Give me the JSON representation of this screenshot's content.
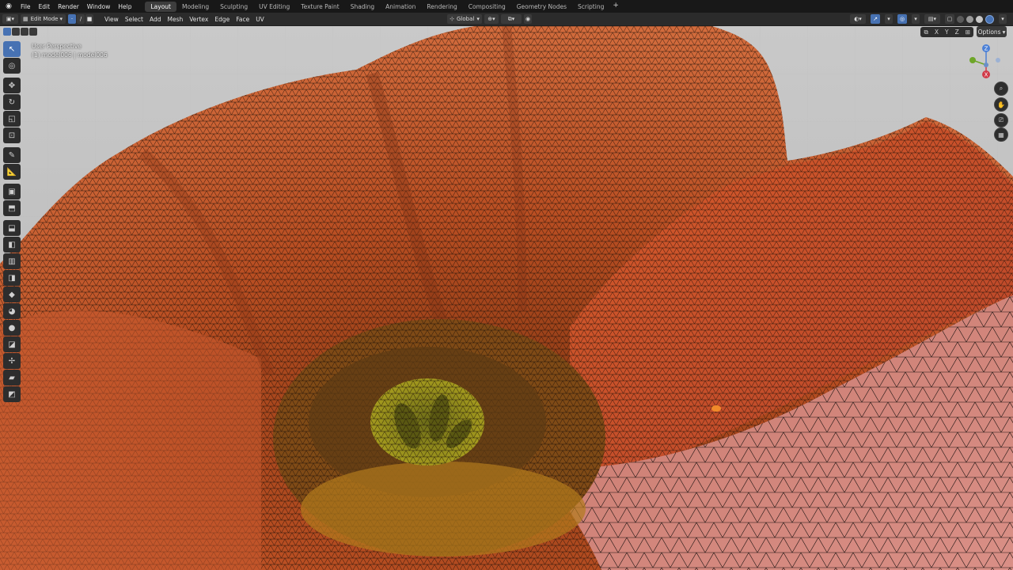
{
  "menu": [
    "File",
    "Edit",
    "Render",
    "Window",
    "Help"
  ],
  "workspaces": [
    "Layout",
    "Modeling",
    "Sculpting",
    "UV Editing",
    "Texture Paint",
    "Shading",
    "Animation",
    "Rendering",
    "Compositing",
    "Geometry Nodes",
    "Scripting"
  ],
  "active_workspace": "Layout",
  "header": {
    "mode": "Edit Mode",
    "view_menu": [
      "View",
      "Select",
      "Add",
      "Mesh",
      "Vertex",
      "Edge",
      "Face",
      "UV"
    ],
    "orientation": "Global",
    "options_label": "Options",
    "axes": [
      "X",
      "Y",
      "Z"
    ]
  },
  "viewport": {
    "view_name": "User Perspective",
    "object_name": "(1) model006 | model006"
  },
  "gizmo": {
    "z": "Z",
    "y": "Y",
    "x": "X"
  },
  "colors": {
    "accent": "#4772b3",
    "petal": "#c8592a",
    "stamen": "#8c8e1c",
    "background": "#3f3f3f"
  }
}
